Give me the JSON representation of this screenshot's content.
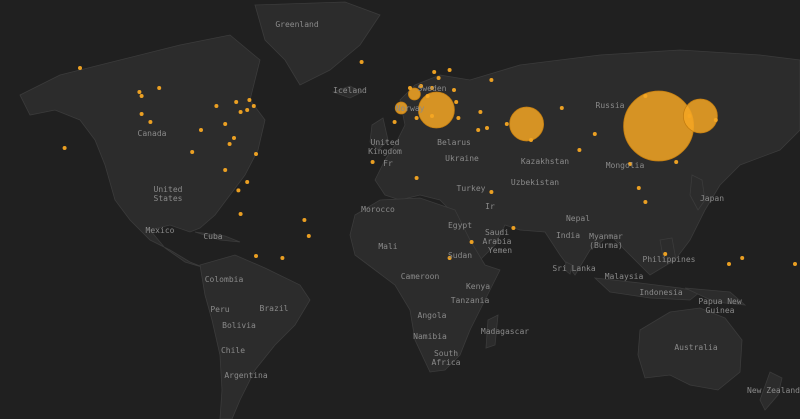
{
  "map": {
    "marker_color": "#f5a623",
    "land_color": "#2c2c2c",
    "water_color": "#202020",
    "labels": [
      {
        "text": "Greenland"
      },
      {
        "text": "Iceland"
      },
      {
        "text": "Sweden"
      },
      {
        "text": "Norway"
      },
      {
        "text": "Russia"
      },
      {
        "text": "Canada"
      },
      {
        "text": "United Kingdom"
      },
      {
        "text": "Belarus"
      },
      {
        "text": "Ukraine"
      },
      {
        "text": "Kazakhstan"
      },
      {
        "text": "Mongolia"
      },
      {
        "text": "United States"
      },
      {
        "text": "Fr"
      },
      {
        "text": "Turkey"
      },
      {
        "text": "Uzbekistan"
      },
      {
        "text": "Morocco"
      },
      {
        "text": "Japan"
      },
      {
        "text": "Ir"
      },
      {
        "text": "Egypt"
      },
      {
        "text": "Saudi Arabia"
      },
      {
        "text": "Nepal"
      },
      {
        "text": "Mexico"
      },
      {
        "text": "Cuba"
      },
      {
        "text": "India"
      },
      {
        "text": "Myanmar (Burma)"
      },
      {
        "text": "Mali"
      },
      {
        "text": "Sudan"
      },
      {
        "text": "Yemen"
      },
      {
        "text": "Philippines"
      },
      {
        "text": "Cameroon"
      },
      {
        "text": "Sri Lanka"
      },
      {
        "text": "Colombia"
      },
      {
        "text": "Kenya"
      },
      {
        "text": "Malaysia"
      },
      {
        "text": "Brazil"
      },
      {
        "text": "Peru"
      },
      {
        "text": "Tanzania"
      },
      {
        "text": "Indonesia"
      },
      {
        "text": "Papua New Guinea"
      },
      {
        "text": "Bolivia"
      },
      {
        "text": "Angola"
      },
      {
        "text": "Madagascar"
      },
      {
        "text": "Namibia"
      },
      {
        "text": "Chile"
      },
      {
        "text": "South Africa"
      },
      {
        "text": "Australia"
      },
      {
        "text": "Argentina"
      },
      {
        "text": "New Zealand"
      }
    ],
    "markers": [
      {
        "lat": 40,
        "lon": 12,
        "size": "xl"
      },
      {
        "lat": 32,
        "lon": 113,
        "size": "xxl"
      },
      {
        "lat": 37,
        "lon": 132,
        "size": "l"
      },
      {
        "lat": 33,
        "lon": 53,
        "size": "l"
      },
      {
        "lat": 48,
        "lon": 2,
        "size": "s"
      },
      {
        "lat": 41,
        "lon": -4,
        "size": "s"
      },
      {
        "lat": 47,
        "lon": 8,
        "size": "xs"
      },
      {
        "lat": 51,
        "lon": 10,
        "size": "xs"
      },
      {
        "lat": 51,
        "lon": 0,
        "size": "xs"
      },
      {
        "lat": 52,
        "lon": 5,
        "size": "xs"
      },
      {
        "lat": 56,
        "lon": 13,
        "size": "xs"
      },
      {
        "lat": 60,
        "lon": 18,
        "size": "xs"
      },
      {
        "lat": 59,
        "lon": 11,
        "size": "xs"
      },
      {
        "lat": 64,
        "lon": -22,
        "size": "xs"
      },
      {
        "lat": 37,
        "lon": 10,
        "size": "xs"
      },
      {
        "lat": 36,
        "lon": 22,
        "size": "xs"
      },
      {
        "lat": 44,
        "lon": 21,
        "size": "xs"
      },
      {
        "lat": 50,
        "lon": 20,
        "size": "xs"
      },
      {
        "lat": 55,
        "lon": 37,
        "size": "xs"
      },
      {
        "lat": 39,
        "lon": 32,
        "size": "xs"
      },
      {
        "lat": 31,
        "lon": 35,
        "size": "xs"
      },
      {
        "lat": 30,
        "lon": 31,
        "size": "xs"
      },
      {
        "lat": 33,
        "lon": 44,
        "size": "xs"
      },
      {
        "lat": 25,
        "lon": 55,
        "size": "xs"
      },
      {
        "lat": 41,
        "lon": 69,
        "size": "xs"
      },
      {
        "lat": 28,
        "lon": 84,
        "size": "xs"
      },
      {
        "lat": 20,
        "lon": 77,
        "size": "xs"
      },
      {
        "lat": 13,
        "lon": 100,
        "size": "xs"
      },
      {
        "lat": 1,
        "lon": 104,
        "size": "xs"
      },
      {
        "lat": 14,
        "lon": 121,
        "size": "xs"
      },
      {
        "lat": 37,
        "lon": 127,
        "size": "xs"
      },
      {
        "lat": 35,
        "lon": 139,
        "size": "xs"
      },
      {
        "lat": 47,
        "lon": 107,
        "size": "xs"
      },
      {
        "lat": -6,
        "lon": 107,
        "size": "xs"
      },
      {
        "lat": -34,
        "lon": 151,
        "size": "xs"
      },
      {
        "lat": -37,
        "lon": 145,
        "size": "xs"
      },
      {
        "lat": -32,
        "lon": 116,
        "size": "xs"
      },
      {
        "lat": -37,
        "lon": 175,
        "size": "xs"
      },
      {
        "lat": -26,
        "lon": 28,
        "size": "xs"
      },
      {
        "lat": -34,
        "lon": 18,
        "size": "xs"
      },
      {
        "lat": -1,
        "lon": 37,
        "size": "xs"
      },
      {
        "lat": 6,
        "lon": 3,
        "size": "xs"
      },
      {
        "lat": 14,
        "lon": -17,
        "size": "xs"
      },
      {
        "lat": 34,
        "lon": -7,
        "size": "xs"
      },
      {
        "lat": 36,
        "lon": 3,
        "size": "xs"
      },
      {
        "lat": -19,
        "lon": 47,
        "size": "xs"
      },
      {
        "lat": 40,
        "lon": -74,
        "size": "xs"
      },
      {
        "lat": 42,
        "lon": -71,
        "size": "xs"
      },
      {
        "lat": 39,
        "lon": -77,
        "size": "xs"
      },
      {
        "lat": 42,
        "lon": -88,
        "size": "xs"
      },
      {
        "lat": 34,
        "lon": -118,
        "size": "xs"
      },
      {
        "lat": 38,
        "lon": -122,
        "size": "xs"
      },
      {
        "lat": 47,
        "lon": -122,
        "size": "xs"
      },
      {
        "lat": 30,
        "lon": -95,
        "size": "xs"
      },
      {
        "lat": 33,
        "lon": -84,
        "size": "xs"
      },
      {
        "lat": 26,
        "lon": -80,
        "size": "xs"
      },
      {
        "lat": 45,
        "lon": -73,
        "size": "xs"
      },
      {
        "lat": 44,
        "lon": -79,
        "size": "xs"
      },
      {
        "lat": 49,
        "lon": -123,
        "size": "xs"
      },
      {
        "lat": 51,
        "lon": -114,
        "size": "xs"
      },
      {
        "lat": 61,
        "lon": -150,
        "size": "xs"
      },
      {
        "lat": 19,
        "lon": -99,
        "size": "xs"
      },
      {
        "lat": 23,
        "lon": -82,
        "size": "xs"
      },
      {
        "lat": 18,
        "lon": -70,
        "size": "xs"
      },
      {
        "lat": 4,
        "lon": -74,
        "size": "xs"
      },
      {
        "lat": -12,
        "lon": -77,
        "size": "xs"
      },
      {
        "lat": -23,
        "lon": -46,
        "size": "xs"
      },
      {
        "lat": -15,
        "lon": -48,
        "size": "xs"
      },
      {
        "lat": -33,
        "lon": -70,
        "size": "xs"
      },
      {
        "lat": -34,
        "lon": -58,
        "size": "xs"
      },
      {
        "lat": 21,
        "lon": -157,
        "size": "xs"
      },
      {
        "lat": 10,
        "lon": -84,
        "size": "xs"
      },
      {
        "lat": -0.2,
        "lon": -78,
        "size": "xs"
      }
    ]
  }
}
